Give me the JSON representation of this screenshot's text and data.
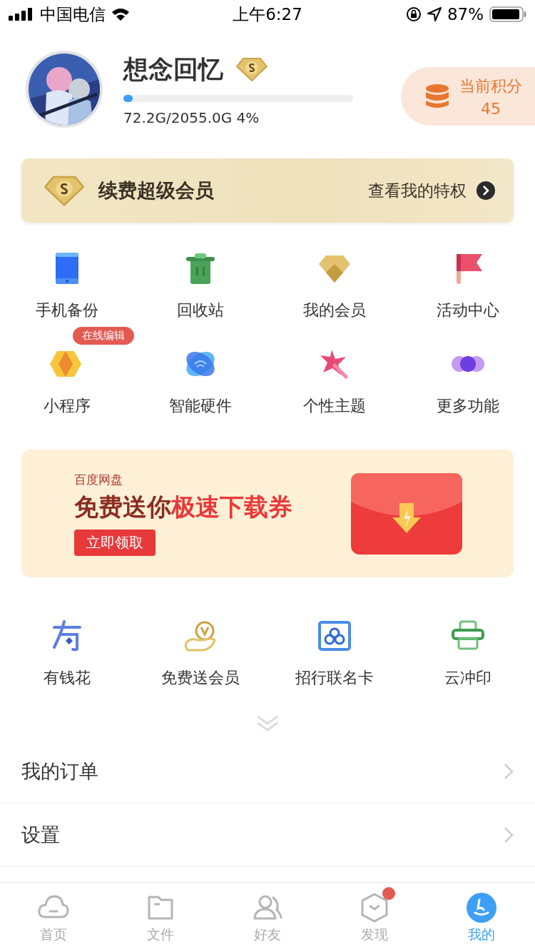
{
  "status_bar": {
    "carrier": "中国电信",
    "time": "上午6:27",
    "battery": "87%"
  },
  "profile": {
    "name": "想念回忆",
    "storage": {
      "level": 0.04,
      "text": "72.2G/2055.0G 4%"
    },
    "points": {
      "label": "当前积分",
      "value": "45"
    }
  },
  "vip_banner": {
    "title": "续费超级会员",
    "link": "查看我的特权"
  },
  "features": [
    {
      "label": "手机备份"
    },
    {
      "label": "回收站"
    },
    {
      "label": "我的会员"
    },
    {
      "label": "活动中心"
    },
    {
      "label": "小程序",
      "badge": "在线编辑"
    },
    {
      "label": "智能硬件"
    },
    {
      "label": "个性主题"
    },
    {
      "label": "更多功能"
    }
  ],
  "promo": {
    "brand": "百度网盘",
    "headline": "免费送你",
    "headline_highlight": "极速下载券",
    "button": "立即领取"
  },
  "services": [
    {
      "label": "有钱花"
    },
    {
      "label": "免费送会员"
    },
    {
      "label": "招行联名卡"
    },
    {
      "label": "云冲印"
    }
  ],
  "menu": [
    {
      "label": "我的订单"
    },
    {
      "label": "设置"
    }
  ],
  "tabs": [
    {
      "label": "首页",
      "selected": false,
      "dot": false
    },
    {
      "label": "文件",
      "selected": false,
      "dot": false
    },
    {
      "label": "好友",
      "selected": false,
      "dot": false
    },
    {
      "label": "发现",
      "selected": false,
      "dot": true
    },
    {
      "label": "我的",
      "selected": true,
      "dot": false
    }
  ]
}
